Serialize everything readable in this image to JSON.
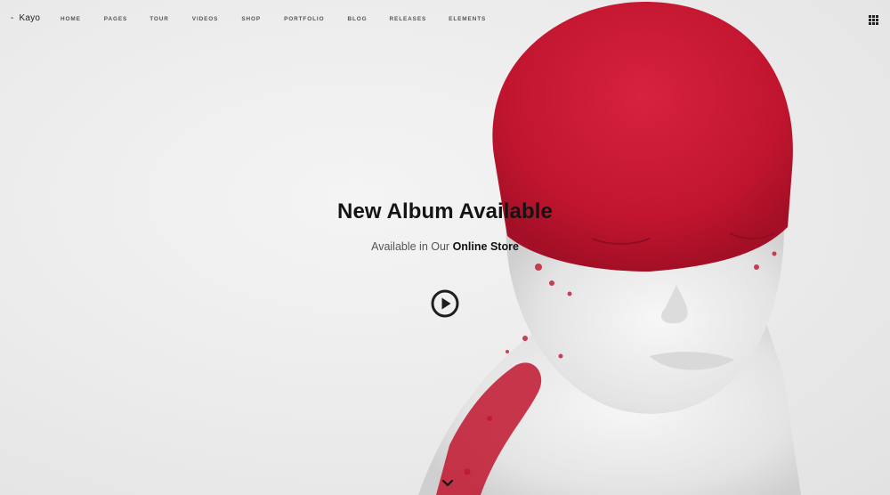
{
  "brand": {
    "dash": "-",
    "name": "Kayo"
  },
  "nav": {
    "items": [
      {
        "label": "HOME",
        "name": "home"
      },
      {
        "label": "PAGES",
        "name": "pages"
      },
      {
        "label": "TOUR",
        "name": "tour"
      },
      {
        "label": "VIDEOS",
        "name": "videos"
      },
      {
        "label": "SHOP",
        "name": "shop"
      },
      {
        "label": "PORTFOLIO",
        "name": "portfolio"
      },
      {
        "label": "BLOG",
        "name": "blog"
      },
      {
        "label": "RELEASES",
        "name": "releases"
      },
      {
        "label": "ELEMENTS",
        "name": "elements"
      }
    ],
    "menu_icon": "grid-menu-icon"
  },
  "hero": {
    "title": "New Album Available",
    "subtitle_prefix": "Available in Our ",
    "subtitle_link": "Online Store",
    "play_icon": "play-circle-icon",
    "scroll_icon": "chevron-down-icon"
  },
  "colors": {
    "accent_red": "#c8183a",
    "text_dark": "#141414",
    "text_muted": "#555555",
    "background": "#ededed"
  }
}
